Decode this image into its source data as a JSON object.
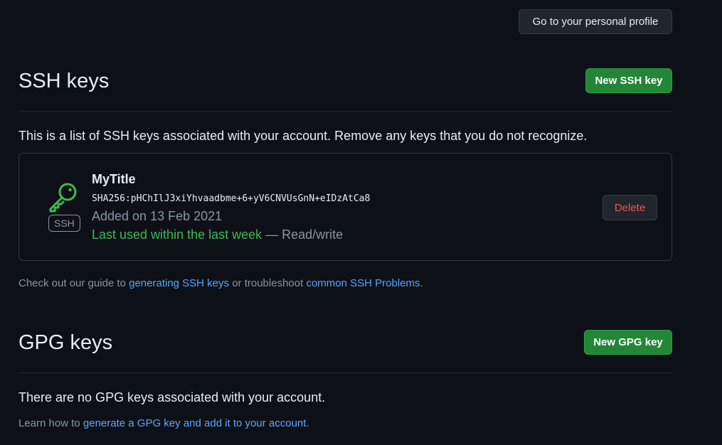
{
  "header": {
    "profile_button": "Go to your personal profile"
  },
  "ssh": {
    "title": "SSH keys",
    "new_button": "New SSH key",
    "description": "This is a list of SSH keys associated with your account. Remove any keys that you do not recognize.",
    "keys": [
      {
        "title": "MyTitle",
        "fingerprint": "SHA256:pHChIlJ3xiYhvaadbme+6+yV6CNVUsGnN+eIDzAtCa8",
        "added": "Added on 13 Feb 2021",
        "last_used": "Last used within the last week",
        "access": " — Read/write",
        "badge": "SSH",
        "delete_button": "Delete",
        "icon": "key-icon"
      }
    ],
    "guide": {
      "prefix": "Check out our guide to ",
      "link1": "generating SSH keys",
      "middle": " or troubleshoot ",
      "link2": "common SSH Problems",
      "suffix": "."
    }
  },
  "gpg": {
    "title": "GPG keys",
    "new_button": "New GPG key",
    "empty_text": "There are no GPG keys associated with your account.",
    "learn": {
      "prefix": "Learn how to ",
      "link": "generate a GPG key and add it to your account",
      "suffix": "."
    }
  },
  "colors": {
    "background": "#0d1117",
    "primary_button": "#238636",
    "danger_text": "#f85149",
    "link": "#58a6ff",
    "success_text": "#3fb950"
  }
}
